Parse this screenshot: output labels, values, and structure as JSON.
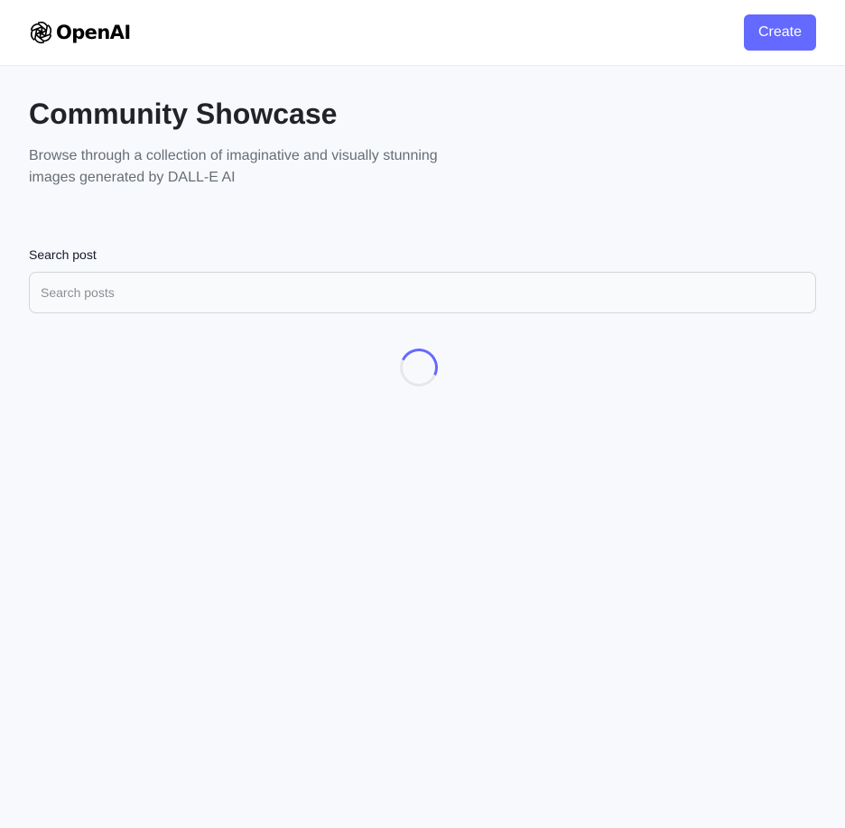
{
  "header": {
    "logo_text": "OpenAI",
    "logo_icon": "openai-logo-icon",
    "create_label": "Create"
  },
  "main": {
    "title": "Community Showcase",
    "subtitle": "Browse through a collection of imaginative and visually stunning images generated by DALL-E AI"
  },
  "search": {
    "label": "Search post",
    "placeholder": "Search posts",
    "value": ""
  },
  "loader": {
    "icon": "loading-spinner-icon"
  },
  "colors": {
    "accent": "#6469ff",
    "page_background": "#f8f9fd",
    "header_background": "#ffffff",
    "title": "#222328",
    "subtitle": "#666e75"
  }
}
